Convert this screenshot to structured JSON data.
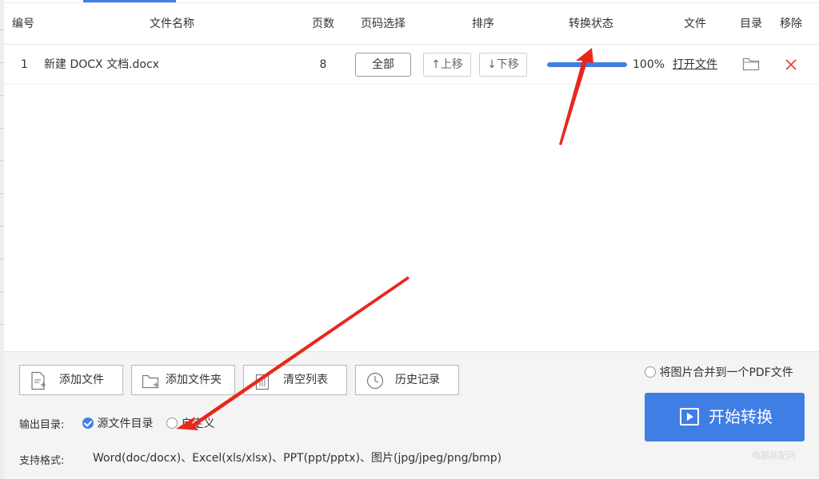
{
  "table": {
    "headers": {
      "index": "编号",
      "filename": "文件名称",
      "pages": "页数",
      "page_select": "页码选择",
      "sort": "排序",
      "status": "转换状态",
      "file": "文件",
      "dir": "目录",
      "remove": "移除"
    },
    "rows": [
      {
        "index": "1",
        "filename": "新建 DOCX 文档.docx",
        "pages": "8",
        "page_select": "全部",
        "move_up": "↑上移",
        "move_down": "↓下移",
        "progress": 100,
        "progress_text": "100%",
        "open_file": "打开文件",
        "dir_icon": "folder-icon",
        "remove_icon": "close-icon"
      }
    ]
  },
  "toolbar": {
    "add_file": "添加文件",
    "add_folder": "添加文件夹",
    "clear_list": "清空列表",
    "history": "历史记录"
  },
  "output": {
    "label": "输出目录:",
    "option_source": "源文件目录",
    "option_custom": "自定义",
    "selected": "源文件目录"
  },
  "formats": {
    "label": "支持格式:",
    "value": "Word(doc/docx)、Excel(xls/xlsx)、PPT(ppt/pptx)、图片(jpg/jpeg/png/bmp)"
  },
  "merge": {
    "label": "将图片合并到一个PDF文件",
    "checked": false
  },
  "start": {
    "label": "开始转换"
  },
  "watermark": "电脑装配网",
  "colors": {
    "accent": "#3f7fe5",
    "remove": "#e8453c",
    "annotation_arrow": "#e8281c"
  }
}
